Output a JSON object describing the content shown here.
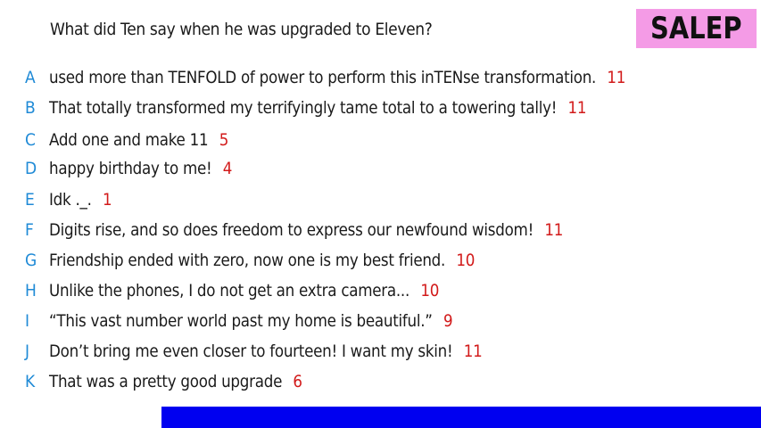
{
  "question": "What did Ten say when he was upgraded to Eleven?",
  "logo": "SALEP",
  "colors": {
    "letter": "#1f8ad6",
    "score": "#d21a1a",
    "logo_bg": "#f49be6",
    "bar": "#0000f0"
  },
  "answers": [
    {
      "letter": "A",
      "text": "used more than TENFOLD of power to perform this inTENse transformation.",
      "score": "11"
    },
    {
      "letter": "B",
      "text": "That totally transformed my terrifyingly tame total to a towering tally!",
      "score": "11"
    },
    {
      "letter": "C",
      "text": "Add one and make 11",
      "score": "5"
    },
    {
      "letter": "D",
      "text": "happy birthday to me!",
      "score": "4"
    },
    {
      "letter": "E",
      "text": "Idk ._.",
      "score": "1"
    },
    {
      "letter": "F",
      "text": "Digits rise, and so does freedom to express our newfound wisdom!",
      "score": "11"
    },
    {
      "letter": "G",
      "text": "Friendship ended with zero, now one is my best friend.",
      "score": "10"
    },
    {
      "letter": "H",
      "text": "Unlike the phones, I do not get an extra camera...",
      "score": "10"
    },
    {
      "letter": "I",
      "text": "“This vast number world past my home is beautiful.”",
      "score": "9"
    },
    {
      "letter": "J",
      "text": "Don’t bring me even closer to fourteen! I want my skin!",
      "score": "11"
    },
    {
      "letter": "K",
      "text": "That was a pretty good upgrade",
      "score": "6"
    }
  ]
}
